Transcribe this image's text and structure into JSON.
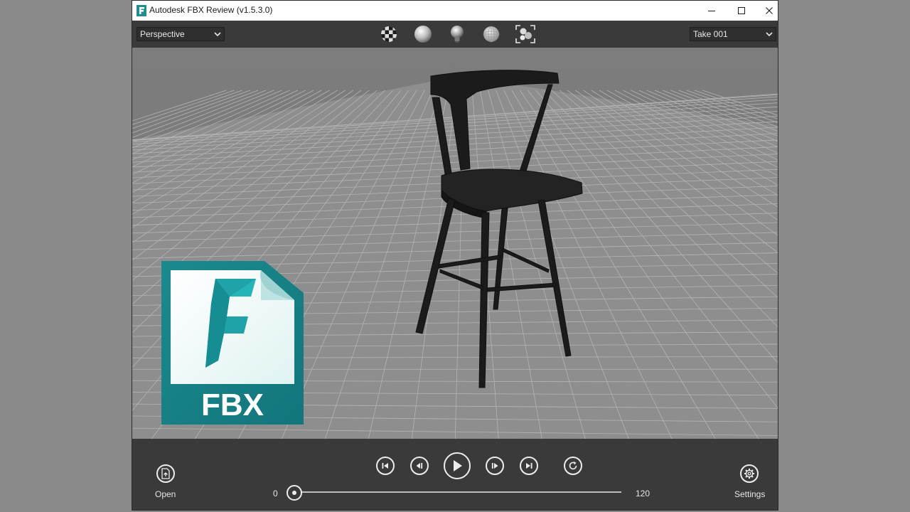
{
  "window": {
    "title": "Autodesk FBX Review (v1.5.3.0)",
    "minimize_icon": "minimize-icon",
    "maximize_icon": "maximize-icon",
    "close_icon": "close-icon"
  },
  "toolbar": {
    "camera_select": "Perspective",
    "take_select": "Take 001",
    "icons": [
      "checker-sphere-icon",
      "shaded-sphere-icon",
      "light-bulb-icon",
      "wireframe-sphere-icon",
      "frame-all-icon"
    ]
  },
  "logo": {
    "text": "FBX",
    "brand_color": "#1e8e93"
  },
  "playback": {
    "open_label": "Open",
    "settings_label": "Settings",
    "start_frame": "0",
    "end_frame": "120",
    "current_position": 0,
    "buttons": [
      "skip-to-start-icon",
      "step-back-icon",
      "play-icon",
      "step-forward-icon",
      "skip-to-end-icon",
      "loop-icon"
    ]
  }
}
